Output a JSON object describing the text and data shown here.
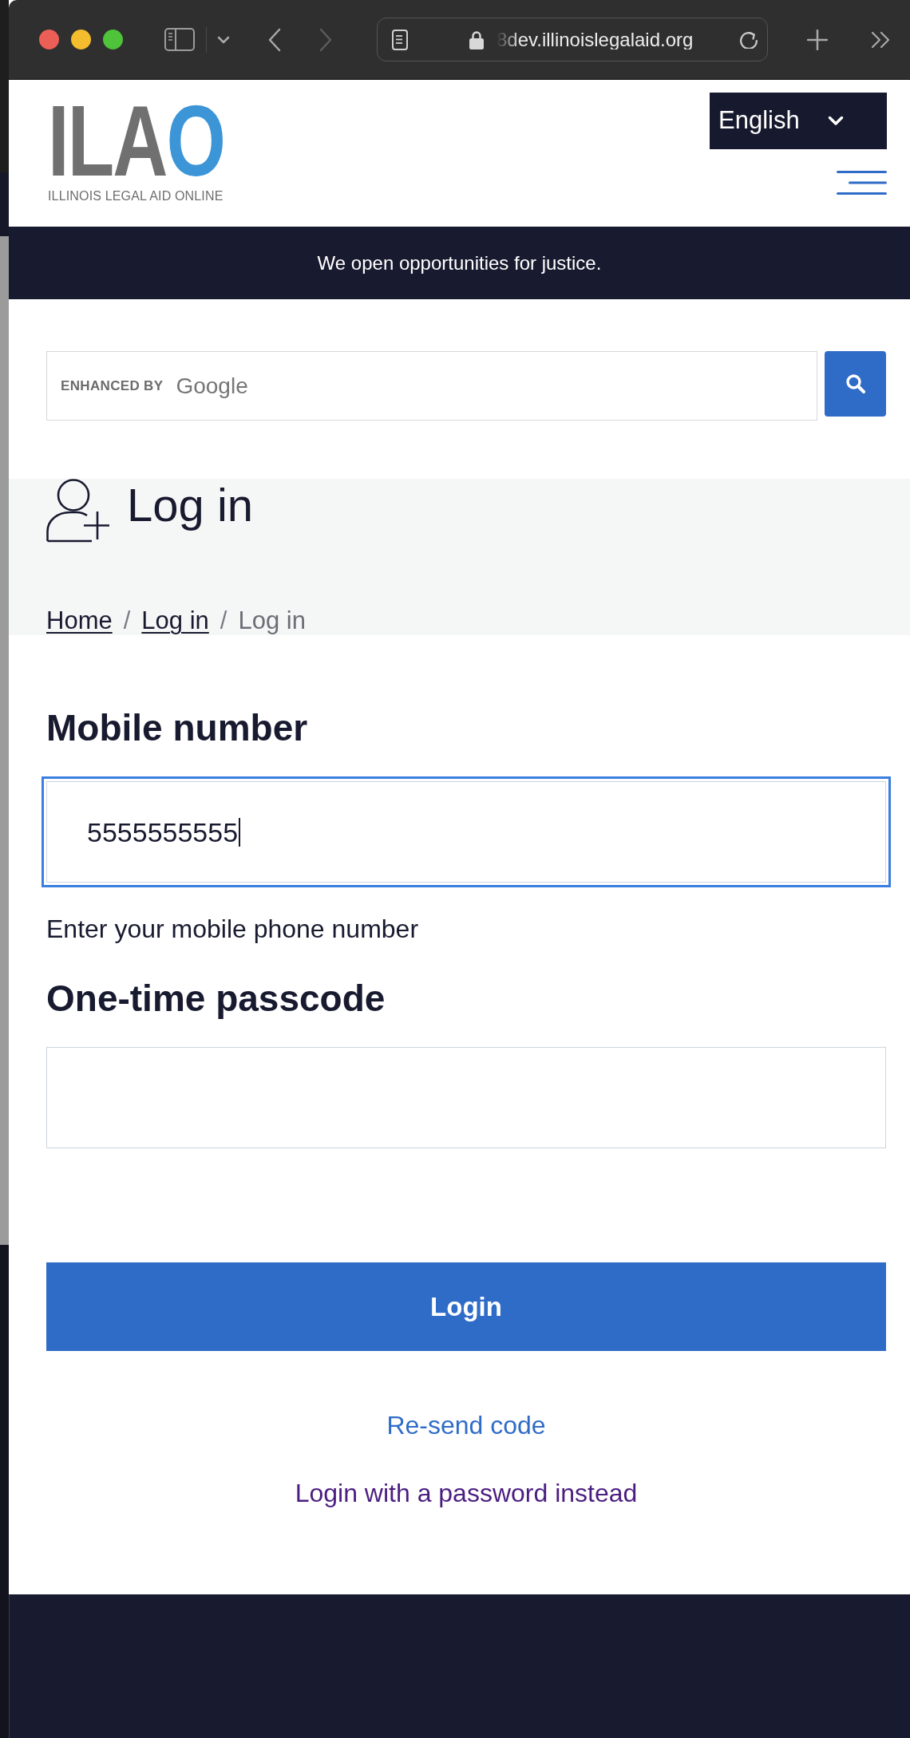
{
  "browser": {
    "url": "8dev.illinoislegalaid.org",
    "nav_buttons": [
      {
        "kind": "back",
        "disabled": false
      },
      {
        "kind": "forward",
        "disabled": true
      }
    ]
  },
  "header": {
    "logo": {
      "mark": "ILAO",
      "tagline": "ILLINOIS LEGAL AID ONLINE"
    },
    "language": {
      "value": "English"
    }
  },
  "banner": {
    "text": "We open opportunities for justice."
  },
  "search": {
    "branding": "ENHANCED BY",
    "branding_logo": "Google"
  },
  "page_title": "Log in",
  "breadcrumb": [
    {
      "kind": "link",
      "label": "Home"
    },
    {
      "kind": "separator",
      "label": "/"
    },
    {
      "kind": "link",
      "label": "Log in"
    },
    {
      "kind": "separator",
      "label": "/"
    },
    {
      "kind": "current",
      "label": "Log in"
    }
  ],
  "form": {
    "fields": [
      {
        "label": "Mobile number",
        "value": "5555555555",
        "focused": true,
        "help": "Enter your mobile phone number"
      },
      {
        "label": "One-time passcode",
        "focused": false
      }
    ],
    "submit": "Login",
    "links": [
      {
        "label": "Re-send code",
        "visited": false
      },
      {
        "label": "Login with a password instead",
        "visited": true
      }
    ]
  }
}
